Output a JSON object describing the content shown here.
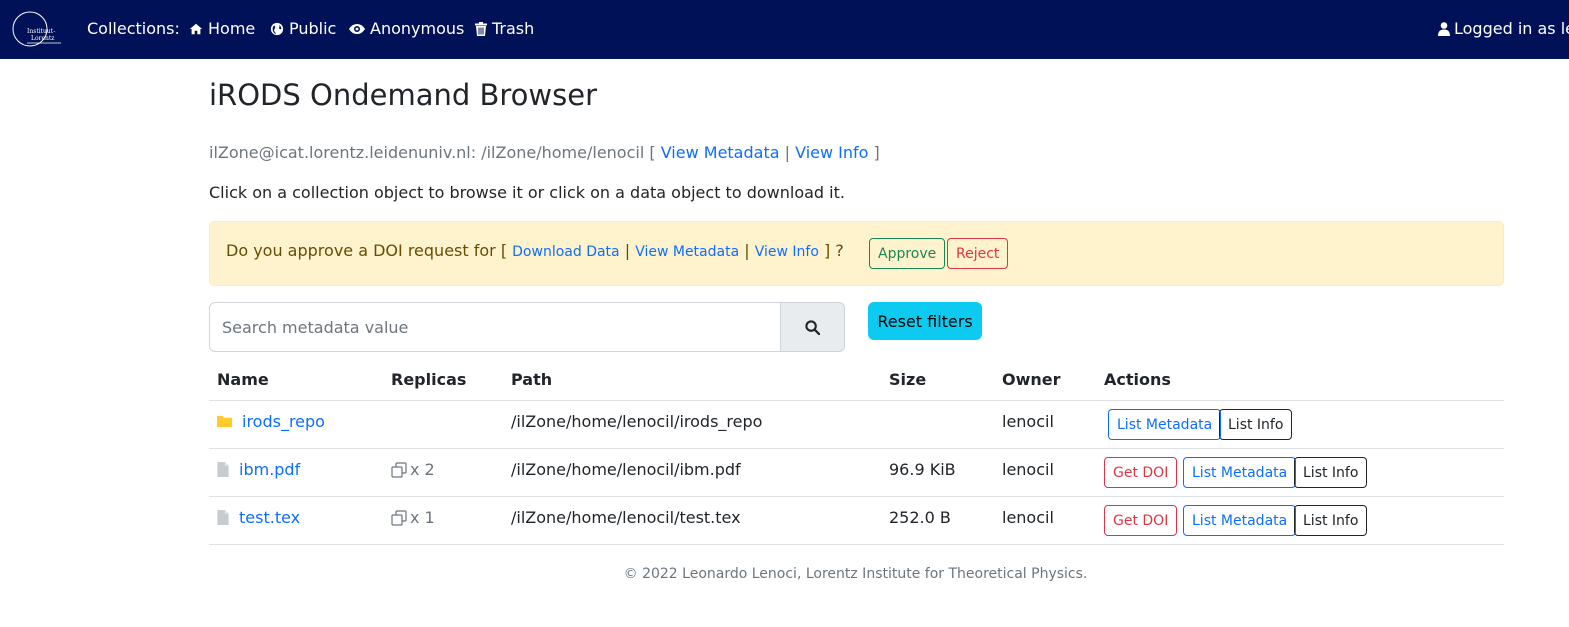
{
  "navbar": {
    "logo_text": "Instituut-Lorentz",
    "collections_label": "Collections:",
    "items": [
      {
        "label": "Home",
        "icon": "home-icon"
      },
      {
        "label": "Public",
        "icon": "globe-icon"
      },
      {
        "label": "Anonymous",
        "icon": "eye-icon"
      },
      {
        "label": "Trash",
        "icon": "trash-icon"
      }
    ],
    "user_label": "Logged in as le"
  },
  "page": {
    "title": "iRODS Ondemand Browser",
    "zone_path": "ilZone@icat.lorentz.leidenuniv.nl: /ilZone/home/lenocil",
    "view_metadata": "View Metadata",
    "view_info": "View Info",
    "instructions": "Click on a collection object to browse it or click on a data object to download it."
  },
  "doi_alert": {
    "question": "Do you approve a DOI request for",
    "download_data": "Download Data",
    "view_metadata": "View Metadata",
    "view_info": "View Info",
    "approve": "Approve",
    "reject": "Reject"
  },
  "search": {
    "placeholder": "Search metadata value",
    "reset_label": "Reset filters"
  },
  "table": {
    "headers": {
      "name": "Name",
      "replicas": "Replicas",
      "path": "Path",
      "size": "Size",
      "owner": "Owner",
      "actions": "Actions"
    },
    "rows": [
      {
        "type": "collection",
        "name": "irods_repo",
        "replicas": "",
        "path": "/ilZone/home/lenocil/irods_repo",
        "size": "",
        "owner": "lenocil",
        "get_doi": "",
        "list_metadata": "List Metadata",
        "list_info": "List Info"
      },
      {
        "type": "file",
        "name": "ibm.pdf",
        "replicas": "x 2",
        "path": "/ilZone/home/lenocil/ibm.pdf",
        "size": "96.9 KiB",
        "owner": "lenocil",
        "get_doi": "Get DOI",
        "list_metadata": "List Metadata",
        "list_info": "List Info"
      },
      {
        "type": "file",
        "name": "test.tex",
        "replicas": "x 1",
        "path": "/ilZone/home/lenocil/test.tex",
        "size": "252.0 B",
        "owner": "lenocil",
        "get_doi": "Get DOI",
        "list_metadata": "List Metadata",
        "list_info": "List Info"
      }
    ]
  },
  "footer": {
    "text": "© 2022 Leonardo Lenoci, Lorentz Institute for Theoretical Physics."
  },
  "colors": {
    "navbar_bg": "#001158",
    "link": "#0d6efd",
    "alert_bg": "#fff3cd",
    "reset_btn": "#0dcaf0",
    "folder": "#ffca2c"
  }
}
